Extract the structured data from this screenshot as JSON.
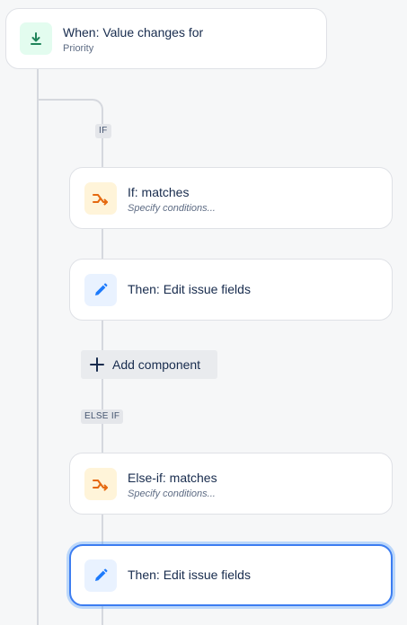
{
  "trigger": {
    "title": "When: Value changes for",
    "subtitle": "Priority",
    "icon": "download-arrow-icon"
  },
  "tags": {
    "if": "IF",
    "else_if": "ELSE IF"
  },
  "if_condition": {
    "title": "If: matches",
    "subtitle": "Specify conditions...",
    "icon": "branch-icon"
  },
  "if_action": {
    "title": "Then: Edit issue fields",
    "icon": "pencil-icon"
  },
  "add_component": {
    "label": "Add component"
  },
  "else_if_condition": {
    "title": "Else-if: matches",
    "subtitle": "Specify conditions...",
    "icon": "branch-icon"
  },
  "else_if_action": {
    "title": "Then: Edit issue fields",
    "icon": "pencil-icon",
    "selected": true
  },
  "colors": {
    "trigger_icon": "#1f845a",
    "condition_icon": "#e56910",
    "action_icon": "#1d7afc",
    "selected_border": "#3c7df1",
    "connector": "#d5d8de"
  }
}
